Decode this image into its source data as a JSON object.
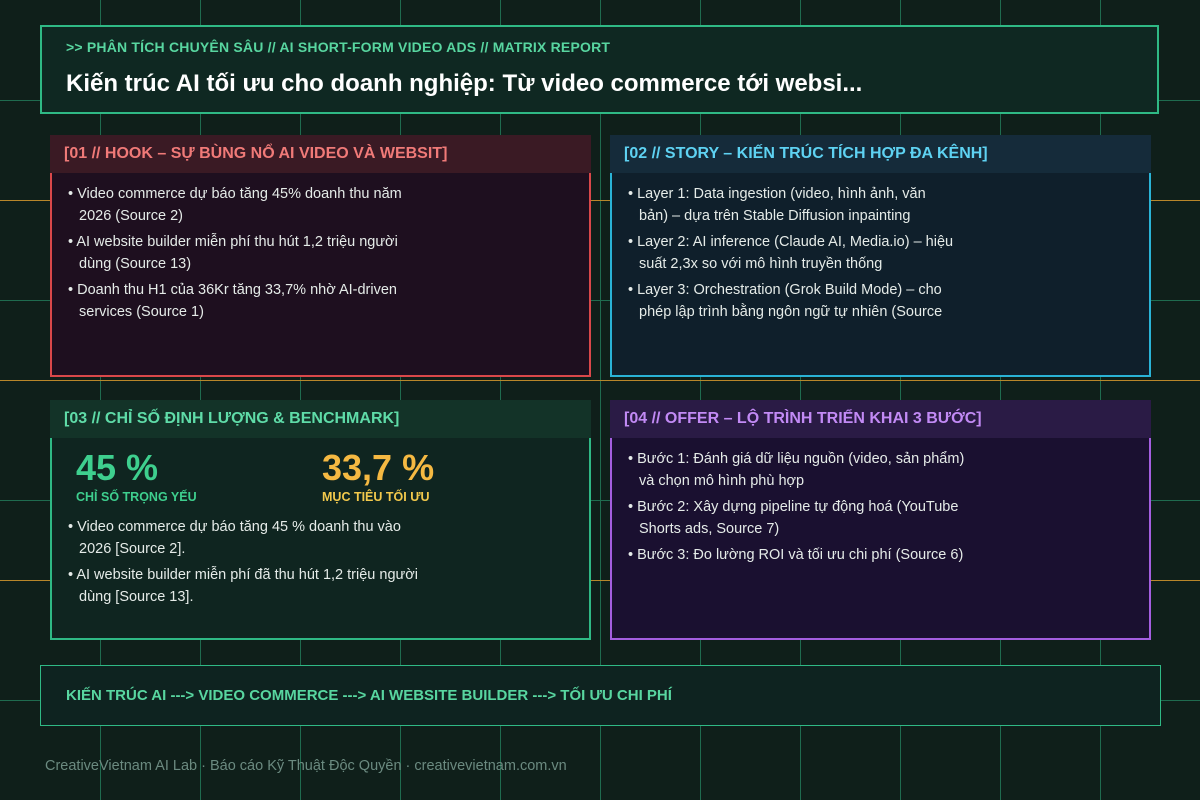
{
  "header": {
    "kicker": ">> PHÂN TÍCH CHUYÊN SÂU // AI SHORT-FORM VIDEO ADS // MATRIX REPORT",
    "title": "Kiến trúc AI tối ưu cho doanh nghiệp: Từ video commerce tới websi..."
  },
  "cards": [
    {
      "heading": "[01 // HOOK – SỰ BÙNG NỔ AI VIDEO VÀ WEBSIT]",
      "items": [
        "Video commerce dự báo tăng 45% doanh thu năm 2026 (Source 2)",
        "AI website builder miễn phí thu hút 1,2 triệu người dùng (Source 13)",
        "Doanh thu H1 của 36Kr tăng 33,7% nhờ AI-driven services (Source 1)"
      ]
    },
    {
      "heading": "[02 // STORY – KIẾN TRÚC TÍCH HỢP ĐA KÊNH]",
      "items": [
        "Layer 1: Data ingestion (video, hình ảnh, văn bản) – dựa trên Stable Diffusion inpainting",
        "Layer 2: AI inference (Claude AI, Media.io) – hiệu suất 2,3x so với mô hình truyền thống",
        "Layer 3: Orchestration (Grok Build Mode) – cho phép lập trình bằng ngôn ngữ tự nhiên (Source"
      ]
    },
    {
      "heading": "[03 // CHỈ SỐ ĐỊNH LƯỢNG & BENCHMARK]",
      "kpis": [
        {
          "value": "45 %",
          "label": "CHỈ SỐ TRỌNG YẾU"
        },
        {
          "value": "33,7 %",
          "label": "MỤC TIÊU TỐI ƯU"
        }
      ],
      "items": [
        "Video commerce dự báo tăng 45 % doanh thu vào 2026 [Source 2].",
        "AI website builder miễn phí đã thu hút 1,2 triệu người dùng [Source 13]."
      ]
    },
    {
      "heading": "[04 // OFFER – LỘ TRÌNH TRIỂN KHAI 3 BƯỚC]",
      "items": [
        "Bước 1: Đánh giá dữ liệu nguồn (video, sản phẩm) và chọn mô hình phù hợp",
        "Bước 2: Xây dựng pipeline tự động hoá (YouTube Shorts ads, Source 7)",
        "Bước 3: Đo lường ROI và tối ưu chi phí (Source 6)"
      ]
    }
  ],
  "flow": "KIẾN TRÚC AI ---> VIDEO COMMERCE ---> AI WEBSITE BUILDER ---> TỐI ƯU CHI PHÍ",
  "footer": "CreativeVietnam AI Lab · Báo cáo Kỹ Thuật Độc Quyền · creativevietnam.com.vn",
  "colors": {
    "background": "#0f1f1a",
    "grid": "#1f6b4f",
    "grid_accent": "#b8862a",
    "accent_green": "#2fb985",
    "hook": "#d9484a",
    "story": "#2ab3d6",
    "offer": "#a45ee0",
    "kpi_yellow": "#f5b942"
  }
}
